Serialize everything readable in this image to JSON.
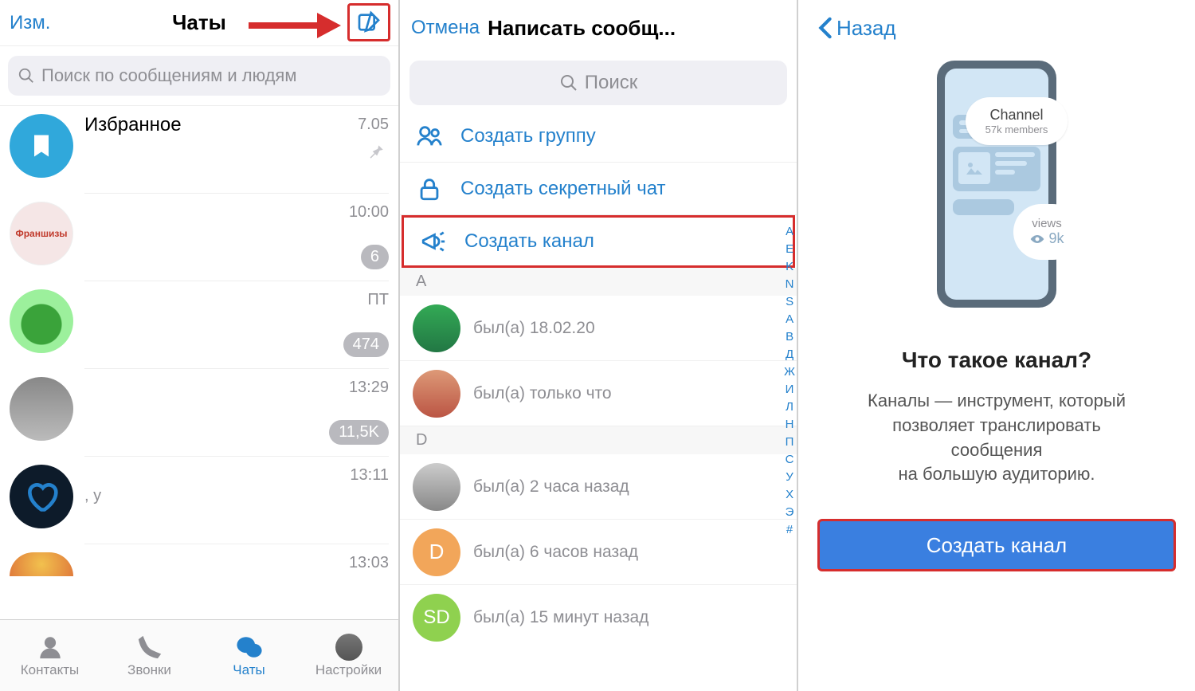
{
  "panel1": {
    "edit": "Изм.",
    "title": "Чаты",
    "search_placeholder": "Поиск по сообщениям и людям",
    "chats": [
      {
        "name": "Избранное",
        "time": "7.05",
        "pinned": true
      },
      {
        "name_small": "Франшизы",
        "time": "10:00",
        "badge": "6"
      },
      {
        "time": "ПТ",
        "badge": "474"
      },
      {
        "time": "13:29",
        "badge": "11,5K"
      },
      {
        "time": "13:11",
        "sub": ", у"
      },
      {
        "time": "13:03"
      }
    ],
    "tabs": {
      "contacts": "Контакты",
      "calls": "Звонки",
      "chats": "Чаты",
      "settings": "Настройки"
    }
  },
  "panel2": {
    "cancel": "Отмена",
    "title": "Написать сообщ...",
    "search_placeholder": "Поиск",
    "options": {
      "group": "Создать группу",
      "secret": "Создать секретный чат",
      "channel": "Создать канал"
    },
    "sections": {
      "A": "A",
      "D": "D"
    },
    "contacts": [
      {
        "status": "был(а) 18.02.20"
      },
      {
        "status": "был(а) только что"
      },
      {
        "status": "был(а) 2 часа назад"
      },
      {
        "initial": "D",
        "status": "был(а) 6 часов назад"
      },
      {
        "initial": "SD",
        "status": "был(а) 15 минут назад"
      }
    ],
    "index": [
      "A",
      "E",
      "K",
      "N",
      "S",
      "А",
      "В",
      "Д",
      "Ж",
      "И",
      "Л",
      "Н",
      "П",
      "С",
      "У",
      "Х",
      "Э",
      "#"
    ]
  },
  "panel3": {
    "back": "Назад",
    "bubble_channel_title": "Channel",
    "bubble_channel_sub": "57k members",
    "bubble_views_label": "views",
    "bubble_views_count": "9k",
    "heading": "Что такое канал?",
    "description_l1": "Каналы — инструмент, который",
    "description_l2": "позволяет транслировать",
    "description_l3": "сообщения",
    "description_l4": "на большую аудиторию.",
    "create_btn": "Создать канал"
  }
}
